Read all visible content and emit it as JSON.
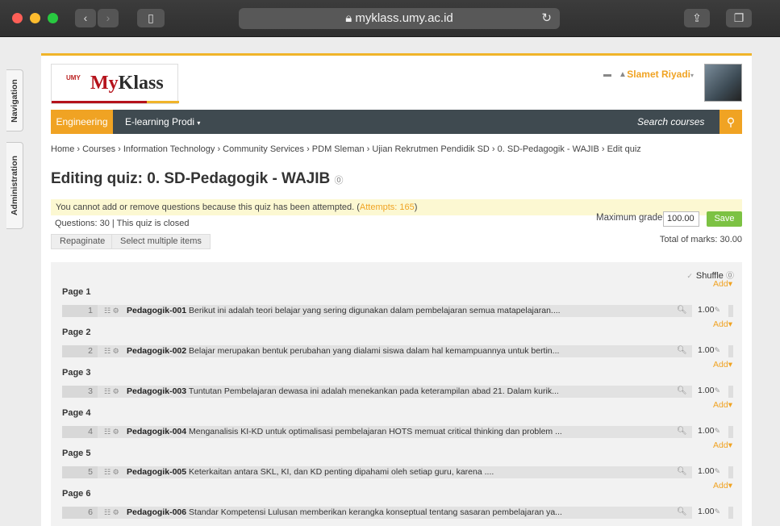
{
  "browser": {
    "url": "myklass.umy.ac.id",
    "lock_icon": "lock-icon",
    "colors": {
      "close": "#fe5f57",
      "minimize": "#febc2e",
      "zoom": "#28c840"
    }
  },
  "sidetabs": {
    "navigation": "Navigation",
    "administration": "Administration"
  },
  "header": {
    "logo_small": "UMY",
    "logo_brand_a": "My",
    "logo_brand_b": "Klass",
    "user_name": "Slamet Riyadi",
    "user_caret": "▾"
  },
  "navbar": {
    "engineering": "Engineering",
    "prodi": "E-learning Prodi",
    "search_placeholder": "Search courses",
    "accent": "#f0a323"
  },
  "breadcrumb": "Home › Courses › Information Technology › Community Services › PDM Sleman › Ujian Rekrutmen Pendidik SD › 0. SD-Pedagogik - WAJIB › Edit quiz",
  "page": {
    "title": "Editing quiz: 0. SD-Pedagogik - WAJIB",
    "notice_text": "You cannot add or remove questions because this quiz has been attempted. (",
    "notice_attempts": "Attempts: 165",
    "notice_end": ")",
    "questions_info": "Questions: 30 | This quiz is closed",
    "max_grade_label": "Maximum grade",
    "max_grade_value": "100.00",
    "save_label": "Save",
    "total_marks": "Total of marks: 30.00",
    "repaginate_label": "Repaginate",
    "select_multiple_label": "Select multiple items",
    "shuffle_label": "Shuffle",
    "add_label": "Add"
  },
  "questions": [
    {
      "page": "Page 1",
      "num": "1",
      "name": "Pedagogik-001",
      "text": "Berikut ini adalah teori belajar yang sering digunakan dalam pembelajaran semua matapelajaran....",
      "mark": "1.00"
    },
    {
      "page": "Page 2",
      "num": "2",
      "name": "Pedagogik-002",
      "text": "Belajar merupakan bentuk perubahan yang dialami siswa dalam hal kemampuannya untuk bertin...",
      "mark": "1.00"
    },
    {
      "page": "Page 3",
      "num": "3",
      "name": "Pedagogik-003",
      "text": "Tuntutan Pembelajaran dewasa ini adalah menekankan pada keterampilan abad 21. Dalam kurik...",
      "mark": "1.00"
    },
    {
      "page": "Page 4",
      "num": "4",
      "name": "Pedagogik-004",
      "text": "Menganalisis KI-KD untuk optimalisasi pembelajaran HOTS memuat critical thinking dan problem ...",
      "mark": "1.00"
    },
    {
      "page": "Page 5",
      "num": "5",
      "name": "Pedagogik-005",
      "text": "Keterkaitan antara SKL, KI, dan KD penting dipahami oleh setiap guru, karena ....",
      "mark": "1.00"
    },
    {
      "page": "Page 6",
      "num": "6",
      "name": "Pedagogik-006",
      "text": "Standar Kompetensi Lulusan memberikan kerangka konseptual tentang sasaran pembelajaran ya...",
      "mark": "1.00"
    }
  ]
}
